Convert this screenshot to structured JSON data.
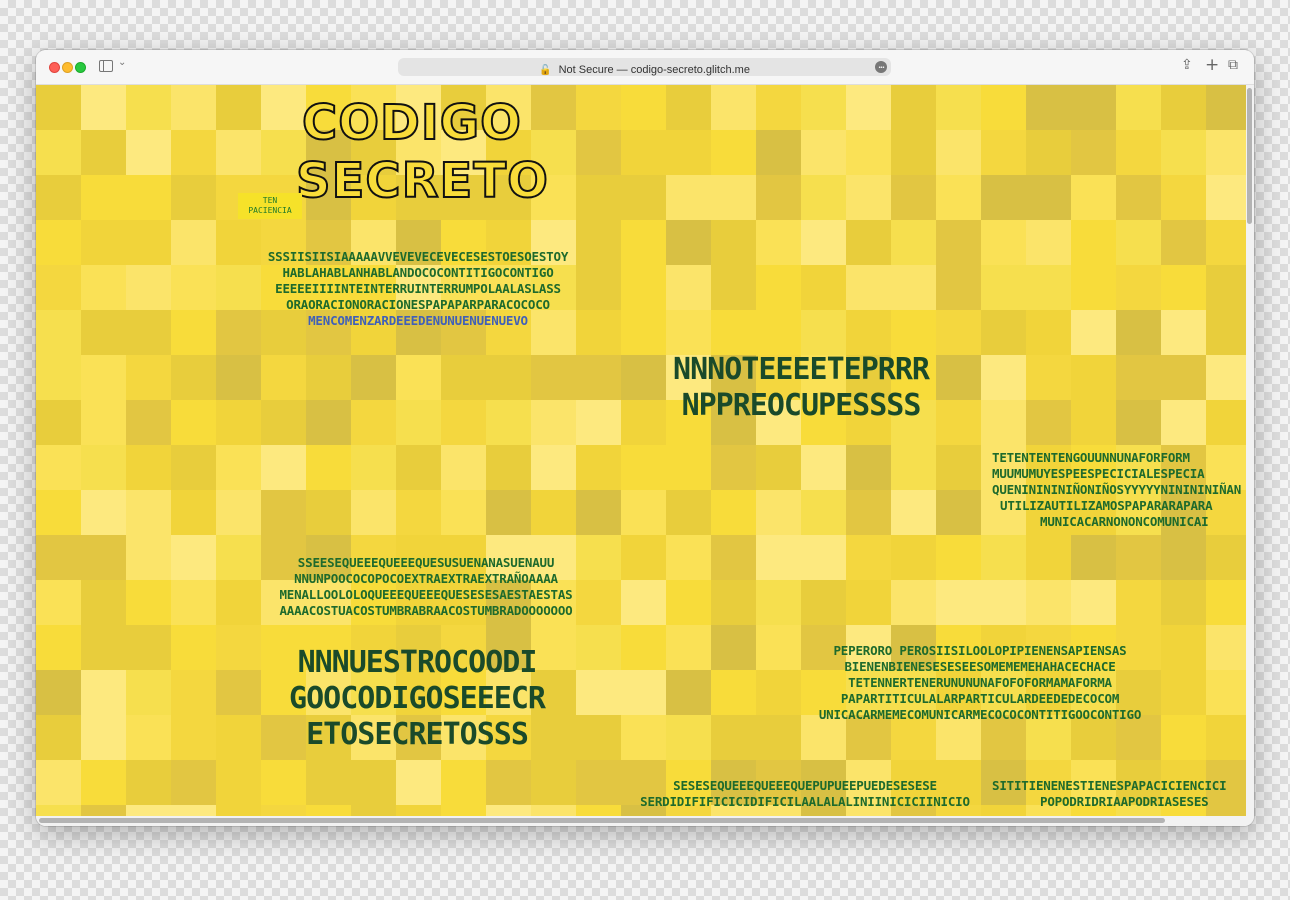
{
  "browser": {
    "url_text": "Not Secure — codigo-secreto.glitch.me",
    "lock_glyph": "🔓",
    "more_glyph": "•••",
    "chevron_glyph": "⌄",
    "share_glyph": "⇪",
    "new_tab_glyph": "+",
    "tabs_glyph": "⧉"
  },
  "page": {
    "title_line1": "CODIGO",
    "title_line2": "SECRETO",
    "badge_line1": "TEN",
    "badge_line2": "PACIENCIA",
    "colors": {
      "background_yellow": "#f8dc3a",
      "text_green": "#1e6a2c",
      "text_dark": "#173c25",
      "text_blue": "#4060b8"
    },
    "block1": [
      "SSSIISIISIAAAAAVVEVEVECEVECESESTOESOESTOY",
      "HABLAHABLANHABLANDOCOCONTITIGOCONTIGO",
      "EEEEEIIIINTEINTERRUINTERRUMPOLAALASLASS",
      "ORAORACIONORACIONESPAPAPARPARACOCOCO",
      "MENCOMENZARDEEEDENUNUENUENUEVO"
    ],
    "block2": [
      "NNNOTEEEETEPRRR",
      "NPPREOCUPESSSS"
    ],
    "block3": [
      "TETENTENTENGOUUNNUNAFORFORM",
      "MUUMUMUYESPEESPECICIALESPECIA",
      "QUENINININIÑONIÑOSYYYYYNINININIÑAN",
      "UTILIZAUTILIZAMOSPAPARARAPARA",
      "MUNICACARNONONCOMUNICAI"
    ],
    "block4": [
      "SSEESEQUEEEQUEEEQUESUSUENANASUENAUU",
      "NNUNPOOCOCOPOCOEXTRAEXTRAEXTRAÑOAAAA",
      "MENALLOOLOLOQUEEEQUEEEQUESESESAESTAESTAS",
      "AAAACOSTUACOSTUMBRABRAACOSTUMBRADOOOOOOO"
    ],
    "block5": [
      "NNNUESTROCOODI",
      "GOOCODIGOSEEECR",
      "ETOSECRETOSSS"
    ],
    "block6": [
      "PEPERORO PEROSIISILOOLOPIPIENENSAPIENSAS",
      "BIENENBIENESESESEESOMEMEMEHAHACECHACE",
      "TETENNERTENERUNUNUNAFOFOFORMAMAFORMA",
      "PAPARTITICULALARPARTICULARDEEDEDECOCOM",
      "UNICACARMEMECOMUNICARMECOCOCONTITIGOOCONTIGO"
    ],
    "block7": [
      "SESESEQUEEEQUEEEQUEPUPUEEPUEDESESESE",
      "SERDIDIFIFICICIDIFICILAALALALINIINICICIINICIO"
    ],
    "block8": [
      "SITITIENENESTIENESPAPACICIENCICI",
      "POPODRIDRIAAPODRIASESES"
    ]
  }
}
